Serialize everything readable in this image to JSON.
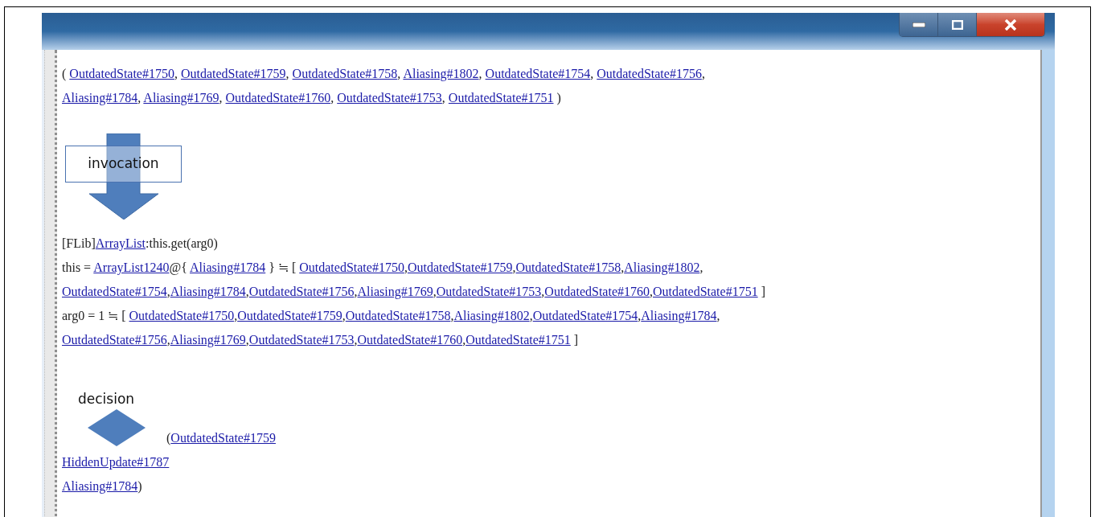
{
  "sections": [
    {
      "kind": "text",
      "lines": [
        [
          {
            "kind": "text",
            "text": "( "
          },
          {
            "kind": "link",
            "text": "OutdatedState#1750"
          },
          {
            "kind": "text",
            "text": ", "
          },
          {
            "kind": "link",
            "text": "OutdatedState#1759"
          },
          {
            "kind": "text",
            "text": ", "
          },
          {
            "kind": "link",
            "text": "OutdatedState#1758"
          },
          {
            "kind": "text",
            "text": ", "
          },
          {
            "kind": "link",
            "text": "Aliasing#1802"
          },
          {
            "kind": "text",
            "text": ", "
          },
          {
            "kind": "link",
            "text": "OutdatedState#1754"
          },
          {
            "kind": "text",
            "text": ", "
          },
          {
            "kind": "link",
            "text": "OutdatedState#1756"
          },
          {
            "kind": "text",
            "text": ","
          }
        ],
        [
          {
            "kind": "link",
            "text": "Aliasing#1784"
          },
          {
            "kind": "text",
            "text": ", "
          },
          {
            "kind": "link",
            "text": "Aliasing#1769"
          },
          {
            "kind": "text",
            "text": ", "
          },
          {
            "kind": "link",
            "text": "OutdatedState#1760"
          },
          {
            "kind": "text",
            "text": ", "
          },
          {
            "kind": "link",
            "text": "OutdatedState#1753"
          },
          {
            "kind": "text",
            "text": ", "
          },
          {
            "kind": "link",
            "text": "OutdatedState#1751"
          },
          {
            "kind": "text",
            "text": " )"
          }
        ]
      ]
    },
    {
      "kind": "invocation",
      "label": "invocation"
    },
    {
      "kind": "text",
      "lines": [
        [
          {
            "kind": "text",
            "text": "[FLib]"
          },
          {
            "kind": "link",
            "text": "ArrayList"
          },
          {
            "kind": "text",
            "text": ":this.get(arg0)"
          }
        ],
        [
          {
            "kind": "text",
            "text": "this = "
          },
          {
            "kind": "link",
            "text": "ArrayList1240"
          },
          {
            "kind": "text",
            "text": "@{ "
          },
          {
            "kind": "link",
            "text": "Aliasing#1784"
          },
          {
            "kind": "text",
            "text": " } ≒ [ "
          },
          {
            "kind": "link",
            "text": "OutdatedState#1750"
          },
          {
            "kind": "text",
            "text": ","
          },
          {
            "kind": "link",
            "text": "OutdatedState#1759"
          },
          {
            "kind": "text",
            "text": ","
          },
          {
            "kind": "link",
            "text": "OutdatedState#1758"
          },
          {
            "kind": "text",
            "text": ","
          },
          {
            "kind": "link",
            "text": "Aliasing#1802"
          },
          {
            "kind": "text",
            "text": ","
          }
        ],
        [
          {
            "kind": "link",
            "text": "OutdatedState#1754"
          },
          {
            "kind": "text",
            "text": ","
          },
          {
            "kind": "link",
            "text": "Aliasing#1784"
          },
          {
            "kind": "text",
            "text": ","
          },
          {
            "kind": "link",
            "text": "OutdatedState#1756"
          },
          {
            "kind": "text",
            "text": ","
          },
          {
            "kind": "link",
            "text": "Aliasing#1769"
          },
          {
            "kind": "text",
            "text": ","
          },
          {
            "kind": "link",
            "text": "OutdatedState#1753"
          },
          {
            "kind": "text",
            "text": ","
          },
          {
            "kind": "link",
            "text": "OutdatedState#1760"
          },
          {
            "kind": "text",
            "text": ","
          },
          {
            "kind": "link",
            "text": "OutdatedState#1751"
          },
          {
            "kind": "text",
            "text": " ]"
          }
        ],
        [
          {
            "kind": "text",
            "text": "arg0 = 1 ≒ [ "
          },
          {
            "kind": "link",
            "text": "OutdatedState#1750"
          },
          {
            "kind": "text",
            "text": ","
          },
          {
            "kind": "link",
            "text": "OutdatedState#1759"
          },
          {
            "kind": "text",
            "text": ","
          },
          {
            "kind": "link",
            "text": "OutdatedState#1758"
          },
          {
            "kind": "text",
            "text": ","
          },
          {
            "kind": "link",
            "text": "Aliasing#1802"
          },
          {
            "kind": "text",
            "text": ","
          },
          {
            "kind": "link",
            "text": "OutdatedState#1754"
          },
          {
            "kind": "text",
            "text": ","
          },
          {
            "kind": "link",
            "text": "Aliasing#1784"
          },
          {
            "kind": "text",
            "text": ","
          }
        ],
        [
          {
            "kind": "link",
            "text": "OutdatedState#1756"
          },
          {
            "kind": "text",
            "text": ","
          },
          {
            "kind": "link",
            "text": "Aliasing#1769"
          },
          {
            "kind": "text",
            "text": ","
          },
          {
            "kind": "link",
            "text": "OutdatedState#1753"
          },
          {
            "kind": "text",
            "text": ","
          },
          {
            "kind": "link",
            "text": "OutdatedState#1760"
          },
          {
            "kind": "text",
            "text": ","
          },
          {
            "kind": "link",
            "text": "OutdatedState#1751"
          },
          {
            "kind": "text",
            "text": " ]"
          }
        ]
      ]
    },
    {
      "kind": "decision",
      "label": "decision",
      "lines": [
        [
          {
            "kind": "text",
            "text": "("
          },
          {
            "kind": "link",
            "text": "OutdatedState#1759"
          }
        ],
        [
          {
            "kind": "link",
            "text": "HiddenUpdate#1787"
          }
        ],
        [
          {
            "kind": "link",
            "text": "Aliasing#1784"
          },
          {
            "kind": "text",
            "text": ")"
          }
        ]
      ]
    }
  ]
}
